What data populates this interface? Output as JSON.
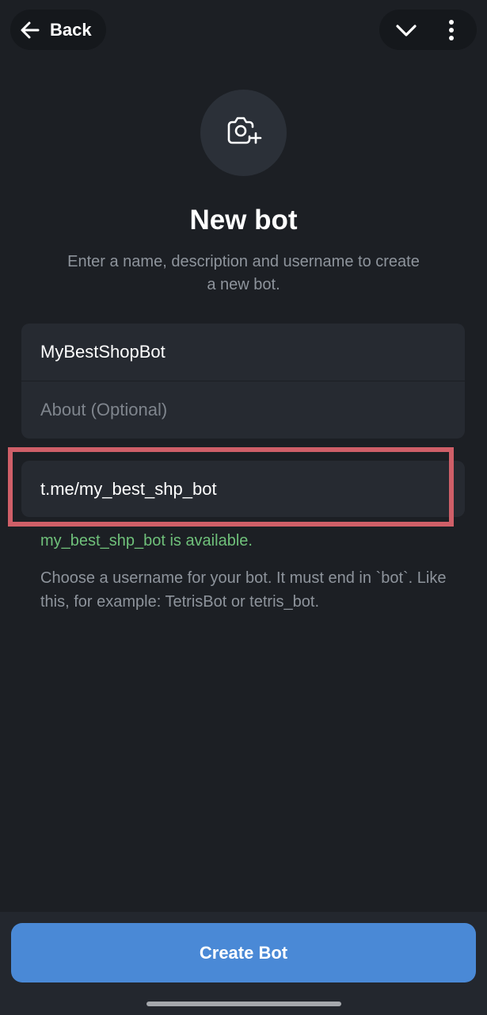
{
  "header": {
    "back_label": "Back",
    "back_icon": "arrow-left-icon",
    "chevron_icon": "chevron-down-icon",
    "more_icon": "more-vertical-icon"
  },
  "avatar": {
    "icon": "camera-add-icon"
  },
  "title": "New bot",
  "subtitle": "Enter a name, description and username to create a new bot.",
  "form": {
    "name_value": "MyBestShopBot",
    "about_placeholder": "About (Optional)",
    "username_value": "t.me/my_best_shp_bot",
    "availability_text": "my_best_shp_bot is available.",
    "hint_text": "Choose a username for your bot. It must end in `bot`. Like this, for example: TetrisBot or tetris_bot."
  },
  "actions": {
    "create_label": "Create Bot"
  },
  "colors": {
    "background": "#1c1f24",
    "field": "#262a31",
    "accent": "#4a89d6",
    "success": "#6fc07a",
    "highlight": "#cf5f68"
  }
}
